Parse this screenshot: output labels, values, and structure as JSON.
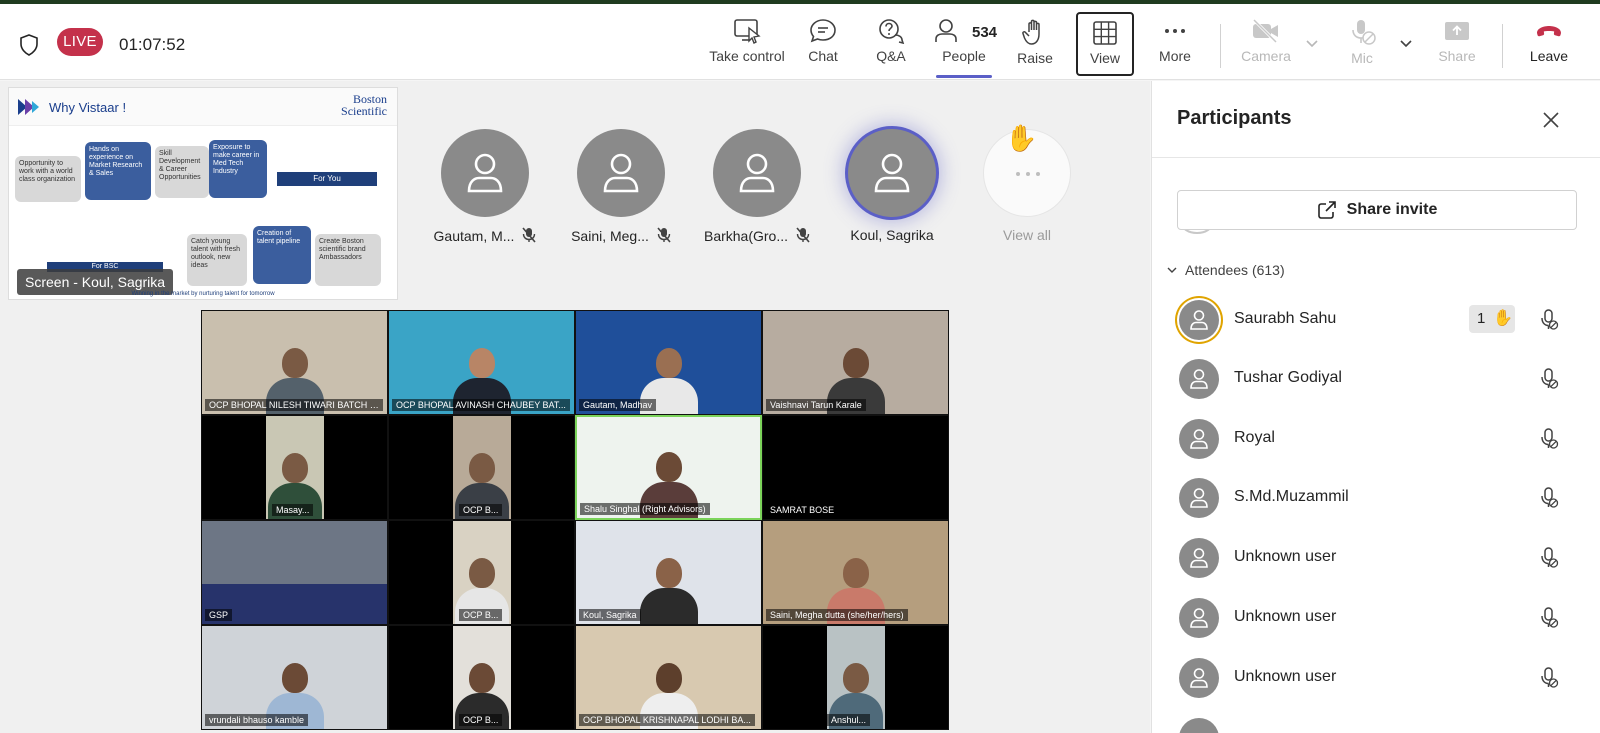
{
  "meeting": {
    "live_label": "LIVE",
    "elapsed": "01:07:52"
  },
  "toolbar": {
    "take_control": "Take control",
    "chat": "Chat",
    "qa": "Q&A",
    "people": "People",
    "people_count": "534",
    "raise": "Raise",
    "view": "View",
    "more": "More",
    "camera": "Camera",
    "mic": "Mic",
    "share": "Share",
    "leave": "Leave"
  },
  "shared_screen": {
    "slide_title": "Why Vistaar !",
    "logo_line1": "Boston",
    "logo_line2": "Scientific",
    "for_you": "For You",
    "for_bsc": "For BSC",
    "footer": "Winning in the market by nurturing talent for tomorrow",
    "caption": "Screen - Koul, Sagrika",
    "pieces": [
      "Opportunity to work with a world class organization",
      "Hands on experience on Market Research & Sales",
      "Skill Development & Career Opportunities",
      "Exposure to make career in Med Tech Industry",
      "Catch young talent with fresh outlook, new ideas",
      "Creation of talent pipeline",
      "Create Boston scientific brand Ambassadors"
    ]
  },
  "featured": [
    {
      "name": "Gautam, M...",
      "muted": true
    },
    {
      "name": "Saini, Meg...",
      "muted": true
    },
    {
      "name": "Barkha(Gro...",
      "muted": true
    },
    {
      "name": "Koul, Sagrika",
      "muted": false
    },
    {
      "name": "View all",
      "muted": false
    }
  ],
  "gallery": [
    "OCP BHOPAL NILESH TIWARI BATCH 2...",
    "OCP BHOPAL AVINASH CHAUBEY BAT...",
    "Gautam, Madhav",
    "Vaishnavi Tarun Karale",
    "Masay...",
    "OCP B...",
    "Shalu Singhal (Right Advisors)",
    "SAMRAT BOSE",
    "GSP",
    "OCP B...",
    "Koul, Sagrika",
    "Saini, Megha dutta (she/her/hers)",
    "vrundali bhauso kamble",
    "OCP B...",
    "OCP BHOPAL KRISHNAPAL LODHI BA...",
    "Anshul..."
  ],
  "panel": {
    "title": "Participants",
    "share_invite": "Share invite",
    "attendees_header": "Attendees (613)",
    "raised_hand_count": "1",
    "attendees": [
      "Saurabh Sahu",
      "Tushar Godiyal",
      "Royal",
      "S.Md.Muzammil",
      "Unknown user",
      "Unknown user",
      "Unknown user"
    ]
  },
  "colors": {
    "accent": "#5b5fc7",
    "live": "#c4314b",
    "leave": "#c4314b",
    "hand_ring": "#e0a400"
  },
  "icons": [
    "shield-icon",
    "take-control-icon",
    "chat-icon",
    "qa-icon",
    "people-icon",
    "raise-hand-icon",
    "view-grid-icon",
    "more-icon",
    "camera-off-icon",
    "mic-off-icon",
    "share-icon",
    "leave-phone-icon",
    "close-icon",
    "share-invite-icon",
    "chevron-down-icon",
    "mic-muted-icon",
    "avatar-person-icon"
  ]
}
